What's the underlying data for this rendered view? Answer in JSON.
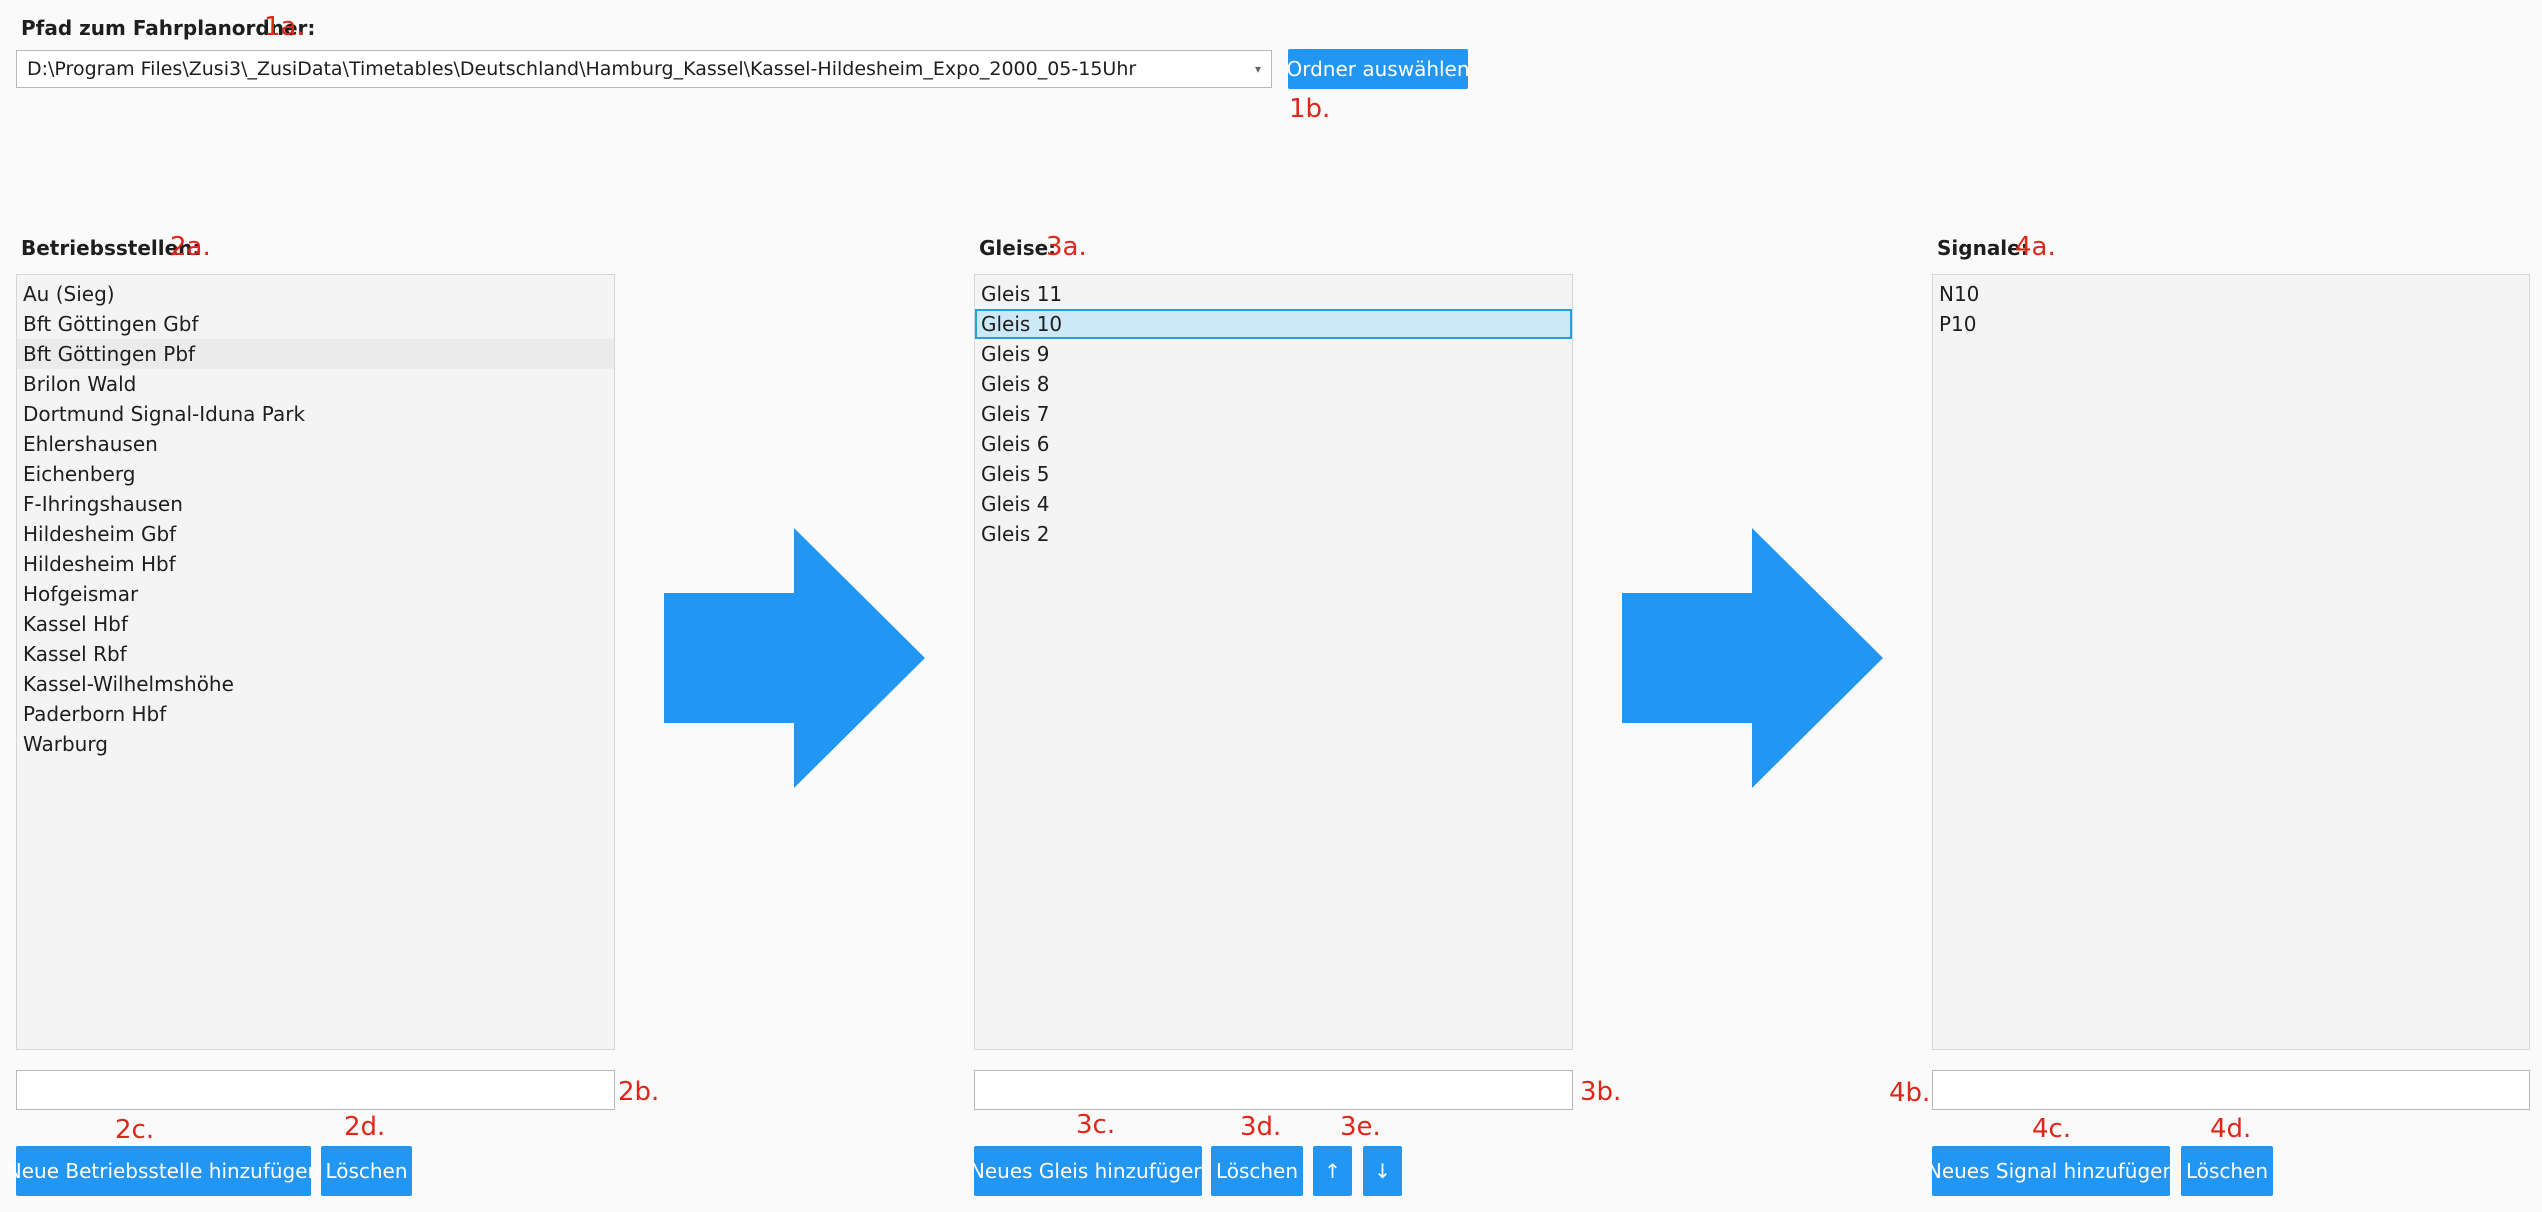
{
  "folder": {
    "label": "Pfad zum Fahrplanordner:",
    "ann_label": "1a.",
    "path": "D:\\Program Files\\Zusi3\\_ZusiData\\Timetables\\Deutschland\\Hamburg_Kassel\\Kassel-Hildesheim_Expo_2000_05-15Uhr",
    "button": "Ordner auswählen",
    "ann_button": "1b."
  },
  "betrieb": {
    "label": "Betriebsstellen:",
    "ann_label": "2a.",
    "items": [
      "Au (Sieg)",
      "Bft Göttingen Gbf",
      "Bft Göttingen Pbf",
      "Brilon Wald",
      "Dortmund Signal-Iduna Park",
      "Ehlershausen",
      "Eichenberg",
      "F-Ihringshausen",
      "Hildesheim Gbf",
      "Hildesheim Hbf",
      "Hofgeismar",
      "Kassel Hbf",
      "Kassel Rbf",
      "Kassel-Wilhelmshöhe",
      "Paderborn Hbf",
      "Warburg"
    ],
    "ann_input": "2b.",
    "ann_add": "2c.",
    "ann_delete": "2d.",
    "add_button": "Neue Betriebsstelle hinzufügen",
    "delete_button": "Löschen"
  },
  "gleise": {
    "label": "Gleise:",
    "ann_label": "3a.",
    "items": [
      "Gleis 11",
      "Gleis 10",
      "Gleis 9",
      "Gleis 8",
      "Gleis 7",
      "Gleis 6",
      "Gleis 5",
      "Gleis 4",
      "Gleis 2"
    ],
    "ann_input": "3b.",
    "ann_add": "3c.",
    "ann_delete": "3d.",
    "ann_move": "3e.",
    "add_button": "Neues Gleis hinzufügen",
    "delete_button": "Löschen",
    "up_button": "↑",
    "down_button": "↓"
  },
  "signale": {
    "label": "Signale:",
    "ann_label": "4a.",
    "items": [
      "N10",
      "P10"
    ],
    "ann_input": "4b.",
    "ann_add": "4c.",
    "ann_delete": "4d.",
    "add_button": "Neues Signal hinzufügen",
    "delete_button": "Löschen"
  },
  "colors": {
    "accent": "#2196f3",
    "annotation": "#e0261b",
    "selection": "#cde8f6"
  }
}
